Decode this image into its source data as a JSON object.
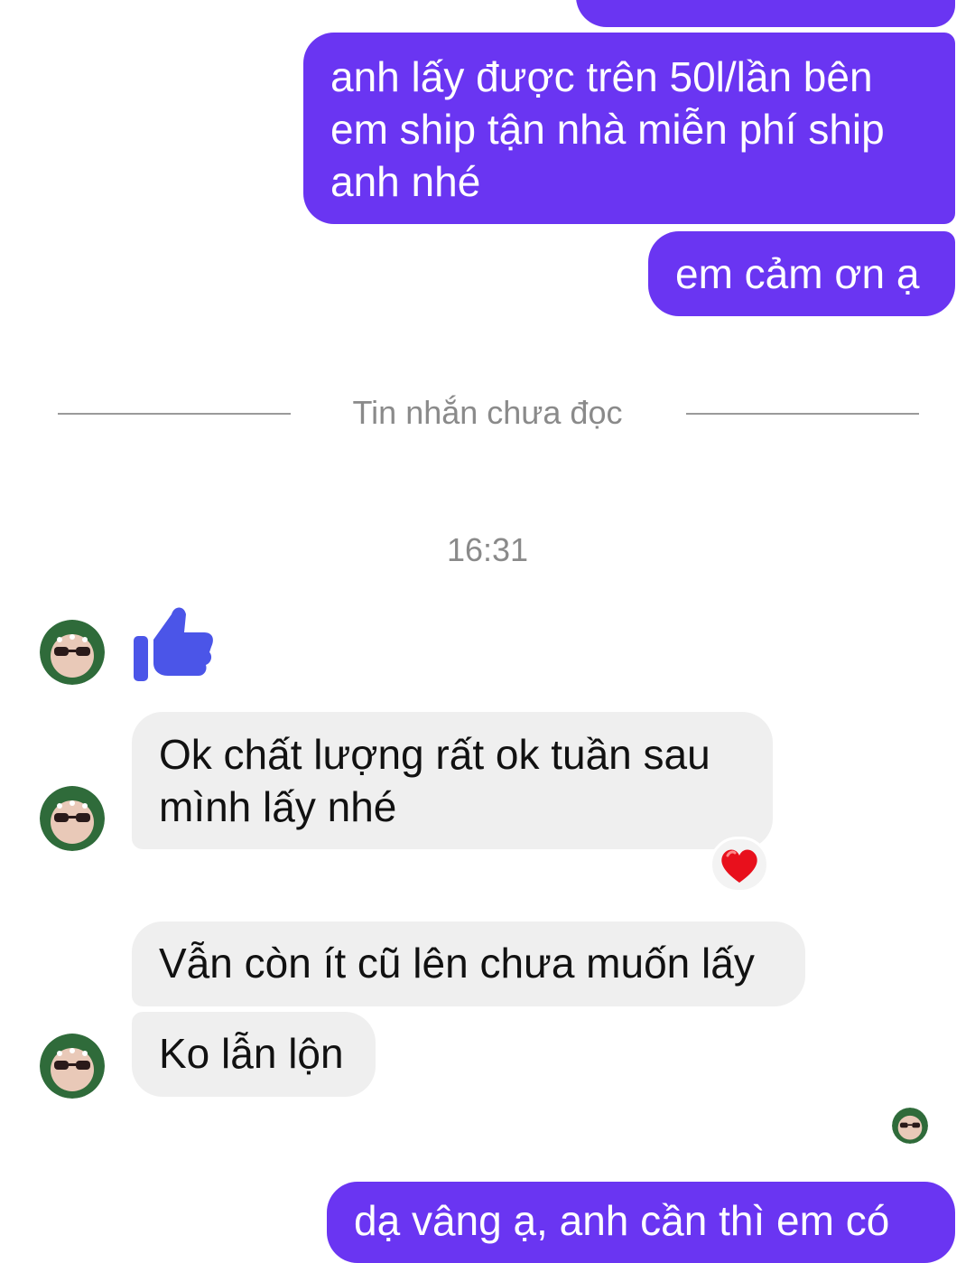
{
  "conversation": {
    "outgoing_top_partial": "",
    "outgoing_1": "anh lấy được trên 50l/lần bên em ship tận nhà miễn phí ship anh nhé",
    "outgoing_2": "em cảm ơn ạ",
    "unread_divider": "Tin nhắn chưa đọc",
    "timestamp": "16:31",
    "incoming_1": "Ok chất lượng rất ok tuần sau mình lấy nhé",
    "incoming_2": "Vẫn còn ít cũ lên chưa muốn lấy",
    "incoming_3": "Ko lẫn lộn",
    "outgoing_bottom_partial": "dạ vâng ạ, anh cần thì em có"
  },
  "icons": {
    "like": "thumbs-up-icon",
    "reaction": "heart-icon",
    "avatar": "avatar",
    "seen_avatar": "seen-avatar"
  },
  "colors": {
    "outgoing_bubble": "#6a35f2",
    "incoming_bubble": "#efefef",
    "like_icon": "#4b55e8",
    "heart": "#e8101c"
  }
}
